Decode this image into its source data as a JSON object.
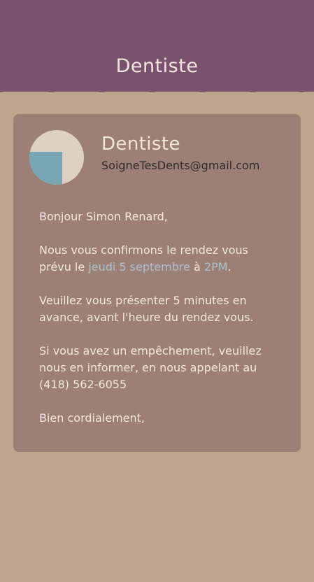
{
  "header": {
    "title": "Dentiste"
  },
  "profile": {
    "name": "Dentiste",
    "email": "SoigneTesDents@gmail.com",
    "avatar_icon": "dentist-avatar-icon"
  },
  "message": {
    "greeting": "Bonjour Simon Renard,",
    "confirm_before": "Nous vous confirmons le rendez vous prévu le ",
    "date": "jeudi 5 septembre",
    "at": " à ",
    "time": "2PM",
    "period": ".",
    "arrive": "Veuillez vous présenter 5 minutes en avance, avant l'heure du rendez vous.",
    "cancel": "Si vous avez un empêchement, veuillez nous en informer, en nous appelant au (418) 562-6055",
    "closing": "Bien cordialement,"
  },
  "colors": {
    "header_bg": "#7a526d",
    "page_bg": "#bfa58e",
    "card_bg": "#9c8076",
    "highlight": "#a9c1cf"
  }
}
